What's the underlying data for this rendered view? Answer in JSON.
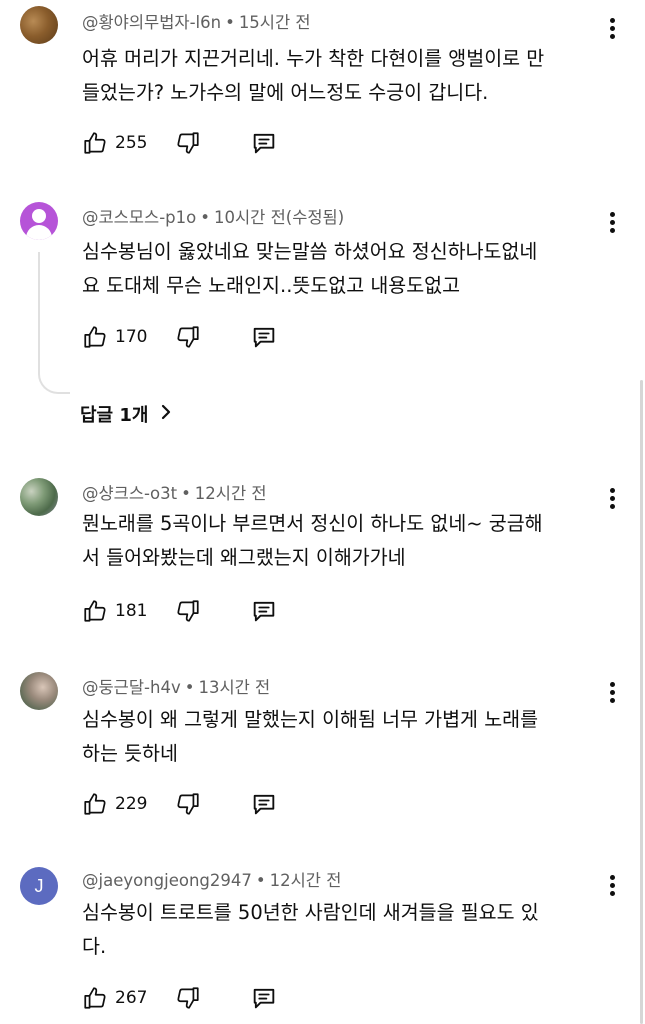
{
  "comments": [
    {
      "handle": "@황야의무법자-l6n",
      "time": "15시간 전",
      "lines": [
        "어휴 머리가 지끈거리네. 누가 착한 다현이를 앵벌이로 만",
        "들었는가? 노가수의 말에 어느정도 수긍이 갑니다."
      ],
      "likes": "255",
      "avatar": "photo"
    },
    {
      "handle": "@코스모스-p1o",
      "time": "10시간 전(수정됨)",
      "lines": [
        "심수봉님이 옳았네요 맞는말씀 하셨어요 정신하나도없네",
        "요 도대체 무슨 노래인지..뜻도없고 내용도없고"
      ],
      "likes": "170",
      "avatar": "default-purple",
      "replies_label": "답글 1개"
    },
    {
      "handle": "@샹크스-o3t",
      "time": "12시간 전",
      "lines": [
        "뭔노래를 5곡이나 부르면서 정신이 하나도 없네~  궁금해",
        "서 들어와봤는데 왜그랬는지 이해가가네"
      ],
      "likes": "181",
      "avatar": "photo"
    },
    {
      "handle": "@둥근달-h4v",
      "time": "13시간 전",
      "lines": [
        "심수봉이 왜 그렇게 말했는지 이해됨 너무 가볍게 노래를",
        "하는 듯하네"
      ],
      "likes": "229",
      "avatar": "photo"
    },
    {
      "handle": "@jaeyongjeong2947",
      "time": "12시간 전",
      "lines": [
        "심수봉이 트로트를 50년한 사람인데 새겨들을 필요도 있",
        "다."
      ],
      "likes": "267",
      "avatar": "letter",
      "avatar_letter": "J"
    }
  ],
  "meta_separator": "•",
  "icons": {
    "like": "thumbs-up-icon",
    "dislike": "thumbs-down-icon",
    "reply": "reply-icon",
    "more": "more-vert-icon",
    "expand": "chevron-right-icon"
  },
  "colors": {
    "meta": "#606060",
    "text": "#0f0f0f",
    "letter_avatar": "#5c6bc0",
    "purple_avatar": "#b654d8"
  }
}
